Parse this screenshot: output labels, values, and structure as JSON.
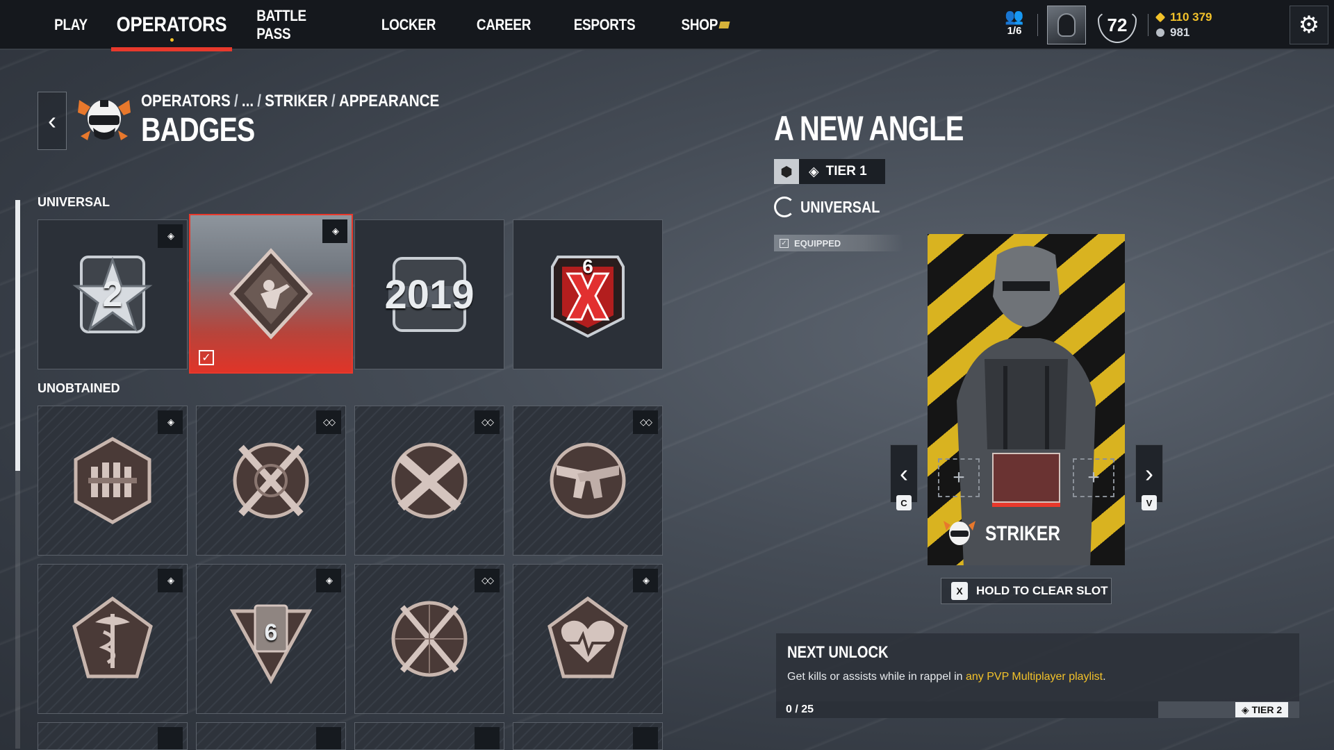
{
  "nav": {
    "items": [
      {
        "label": "PLAY"
      },
      {
        "label": "OPERATORS",
        "active": true
      },
      {
        "label": "BATTLE PASS"
      },
      {
        "label": "LOCKER"
      },
      {
        "label": "CAREER"
      },
      {
        "label": "ESPORTS"
      },
      {
        "label": "SHOP"
      }
    ]
  },
  "status": {
    "squad": "1/6",
    "level": "72",
    "renown": "110 379",
    "credits": "981",
    "accent_color": "#e8392c",
    "gold_color": "#f3c22a"
  },
  "header": {
    "breadcrumb": [
      "OPERATORS",
      "...",
      "STRIKER",
      "APPEARANCE"
    ],
    "title": "BADGES"
  },
  "sections": {
    "universal": "UNIVERSAL",
    "unobtained": "UNOBTAINED"
  },
  "badges": {
    "universal": [
      {
        "icon": "star-2-badge-icon",
        "text": "2",
        "rarity": "◈"
      },
      {
        "icon": "soldier-diamond-badge-icon",
        "rarity": "◈",
        "selected": true,
        "equipped": true
      },
      {
        "icon": "year-2019-badge-icon",
        "text": "2019"
      },
      {
        "icon": "siege-x-badge-icon",
        "text": "6"
      }
    ],
    "unobtained": [
      {
        "icon": "ammo-hexagon-badge-icon",
        "rarity": "◈"
      },
      {
        "icon": "crossed-rifles-badge-icon",
        "rarity": "◇◇"
      },
      {
        "icon": "crossed-smgs-badge-icon",
        "rarity": "◇◇"
      },
      {
        "icon": "crossed-pistols-badge-icon",
        "rarity": "◇◇"
      },
      {
        "icon": "medic-caduceus-badge-icon",
        "rarity": "◈"
      },
      {
        "icon": "six-shield-badge-icon",
        "text": "6",
        "rarity": "◈"
      },
      {
        "icon": "crossed-snipers-badge-icon",
        "rarity": "◇◇"
      },
      {
        "icon": "heart-pentagon-badge-icon",
        "rarity": "◈"
      }
    ]
  },
  "detail": {
    "title": "A NEW ANGLE",
    "tier": "TIER 1",
    "type": "UNIVERSAL",
    "equipped": "EQUIPPED",
    "operator": "STRIKER",
    "prev_key": "C",
    "next_key": "V",
    "clear_key": "X",
    "clear_label": "HOLD TO CLEAR SLOT"
  },
  "next_unlock": {
    "heading": "NEXT UNLOCK",
    "desc_prefix": "Get kills or assists while in rappel in ",
    "desc_highlight": "any PVP Multiplayer playlist",
    "desc_suffix": ".",
    "progress": "0 / 25",
    "progress_fraction": 0,
    "tier": "TIER 2"
  }
}
